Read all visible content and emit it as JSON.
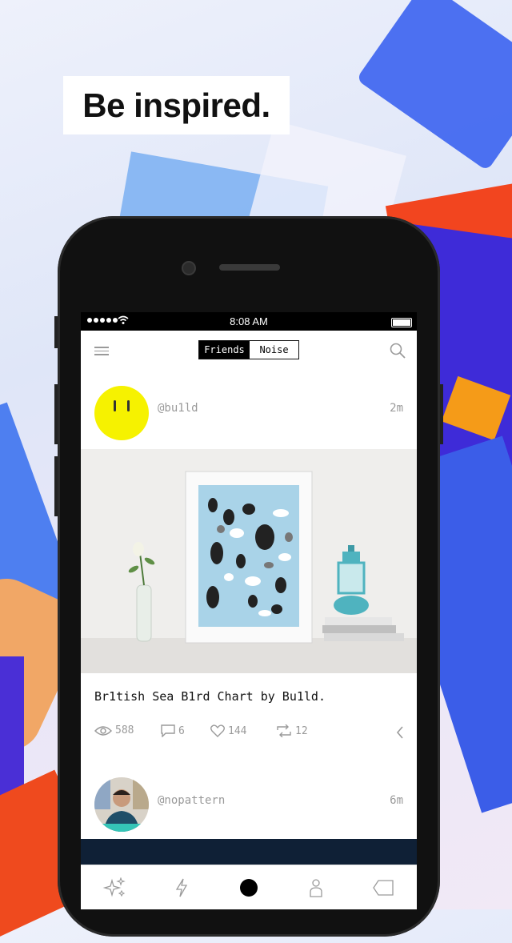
{
  "promo": {
    "tagline": "Be inspired."
  },
  "statusbar": {
    "time": "8:08 AM"
  },
  "navbar": {
    "tabs": [
      {
        "label": "Friends",
        "active": true
      },
      {
        "label": "Noise",
        "active": false
      }
    ],
    "menu_icon": "hamburger-icon",
    "search_icon": "search-icon"
  },
  "feed": {
    "posts": [
      {
        "handle": "@bu1ld",
        "time": "2m",
        "caption": "Br1tish Sea B1rd Chart by Bu1ld.",
        "stats": {
          "views": "588",
          "comments": "6",
          "likes": "144",
          "reposts": "12"
        }
      },
      {
        "handle": "@nopattern",
        "time": "6m"
      }
    ]
  },
  "tabbar": {
    "items": [
      "sparkles-icon",
      "lightning-icon",
      "home-dot-icon",
      "profile-icon",
      "tag-icon"
    ]
  },
  "colors": {
    "accent": "#000000",
    "muted": "#9a9a9a",
    "avatar_yellow": "#f6f200"
  }
}
